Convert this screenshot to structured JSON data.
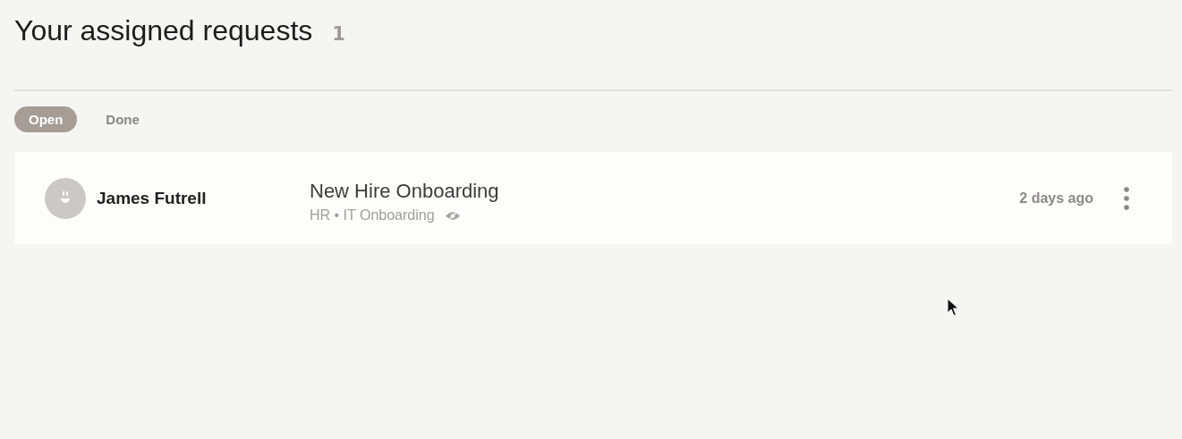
{
  "header": {
    "title": "Your assigned requests",
    "count": "1"
  },
  "tabs": [
    {
      "label": "Open",
      "selected": true
    },
    {
      "label": "Done",
      "selected": false
    }
  ],
  "requests": [
    {
      "assignee": "James Futrell",
      "title": "New Hire Onboarding",
      "subtitle": "HR • IT Onboarding",
      "watched": true,
      "time": "2 days ago"
    }
  ]
}
